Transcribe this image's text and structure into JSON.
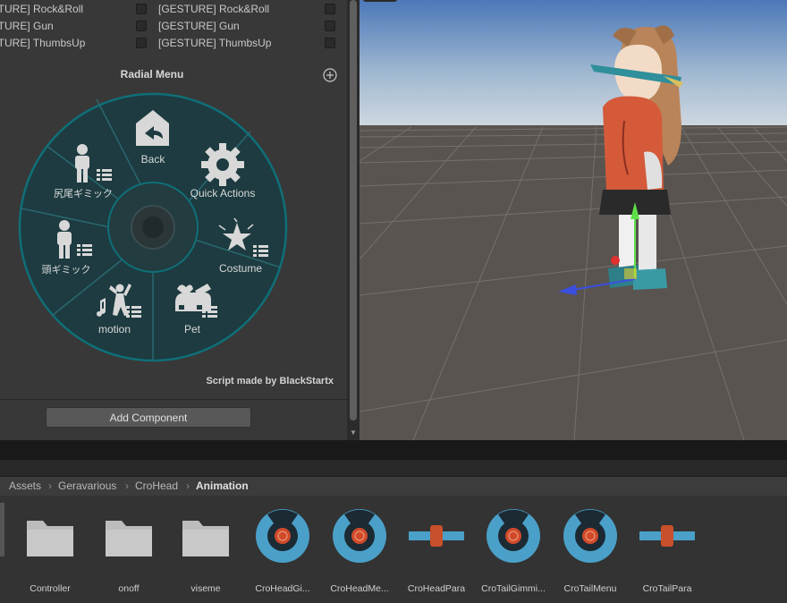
{
  "inspector": {
    "gesture_rows": [
      {
        "left_label": "[GESTURE] Rock&Roll",
        "right_label": "[GESTURE] Rock&Roll"
      },
      {
        "left_label": "[GESTURE] Gun",
        "right_label": "[GESTURE] Gun"
      },
      {
        "left_label": "[GESTURE] ThumbsUp",
        "right_label": "[GESTURE] ThumbsUp"
      }
    ],
    "radial_menu_title": "Radial Menu",
    "radial_items": [
      {
        "label": "Back",
        "icon": "back-arrow-icon"
      },
      {
        "label": "Quick Actions",
        "icon": "gear-icon"
      },
      {
        "label": "Costume",
        "icon": "sparkle-submenu-icon"
      },
      {
        "label": "Pet",
        "icon": "pet-submenu-icon"
      },
      {
        "label": "motion",
        "icon": "dance-submenu-icon"
      },
      {
        "label": "頭ギミック",
        "icon": "person-submenu-icon"
      },
      {
        "label": "尻尾ギミック",
        "icon": "person-submenu-icon"
      }
    ],
    "script_credit": "Script made by BlackStartx",
    "add_component_label": "Add Component"
  },
  "colors": {
    "radial_fill": "#1d3b40",
    "radial_stroke": "#0f6f78",
    "accent": "#e0e0e0"
  },
  "breadcrumb": [
    "Assets",
    "Geravarious",
    "CroHead",
    "Animation"
  ],
  "assets": [
    {
      "label": "Controller",
      "icon": "folder-icon"
    },
    {
      "label": "onoff",
      "icon": "folder-icon"
    },
    {
      "label": "viseme",
      "icon": "folder-icon"
    },
    {
      "label": "CroHeadGi...",
      "icon": "expression-menu-icon"
    },
    {
      "label": "CroHeadMe...",
      "icon": "expression-menu-icon"
    },
    {
      "label": "CroHeadPara",
      "icon": "expression-parameters-icon"
    },
    {
      "label": "CroTailGimmi...",
      "icon": "expression-menu-icon"
    },
    {
      "label": "CroTailMenu",
      "icon": "expression-menu-icon"
    },
    {
      "label": "CroTailPara",
      "icon": "expression-parameters-icon"
    }
  ]
}
